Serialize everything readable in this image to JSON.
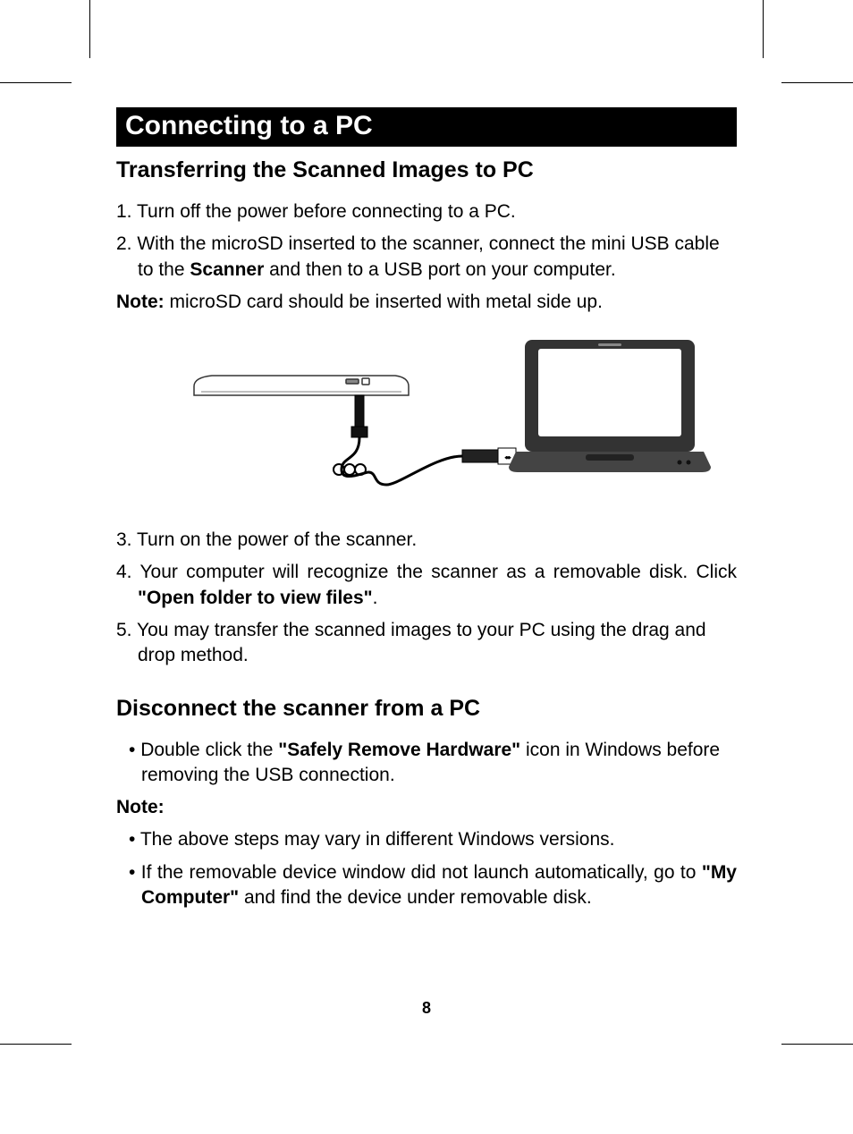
{
  "section_title": "Connecting to a PC",
  "heading1": "Transferring the Scanned Images to PC",
  "steps1": {
    "s1": {
      "num": "1.",
      "text": "Turn off the power before connecting to a PC."
    },
    "s2": {
      "num": "2.",
      "prefix": "With the microSD inserted to the scanner, connect the mini USB cable to the ",
      "bold": "Scanner",
      "suffix": " and then to a USB port on your computer."
    }
  },
  "note1": {
    "label": "Note:",
    "text": " microSD card should be inserted with metal side up."
  },
  "steps2": {
    "s3": {
      "num": "3.",
      "text": "Turn on the power of the scanner."
    },
    "s4": {
      "num": "4.",
      "prefix": "Your computer will recognize the scanner as a removable disk. Click ",
      "bold": "\"Open folder to view files\"",
      "suffix": "."
    },
    "s5": {
      "num": "5.",
      "text": "You may transfer the scanned images to your PC using the drag and drop method."
    }
  },
  "heading2": "Disconnect the scanner from a PC",
  "bullets1": {
    "b1": {
      "prefix": "Double click the ",
      "bold": "\"Safely Remove Hardware\"",
      "suffix": " icon in Windows before removing the USB connection."
    }
  },
  "note2_label": "Note:",
  "bullets2": {
    "b1": {
      "text": "The above steps may vary in different Windows versions."
    },
    "b2": {
      "prefix": "If the removable device window did not launch automatically, go to ",
      "bold": "\"My Computer\"",
      "suffix": " and find the device under removable disk."
    }
  },
  "page_number": "8"
}
